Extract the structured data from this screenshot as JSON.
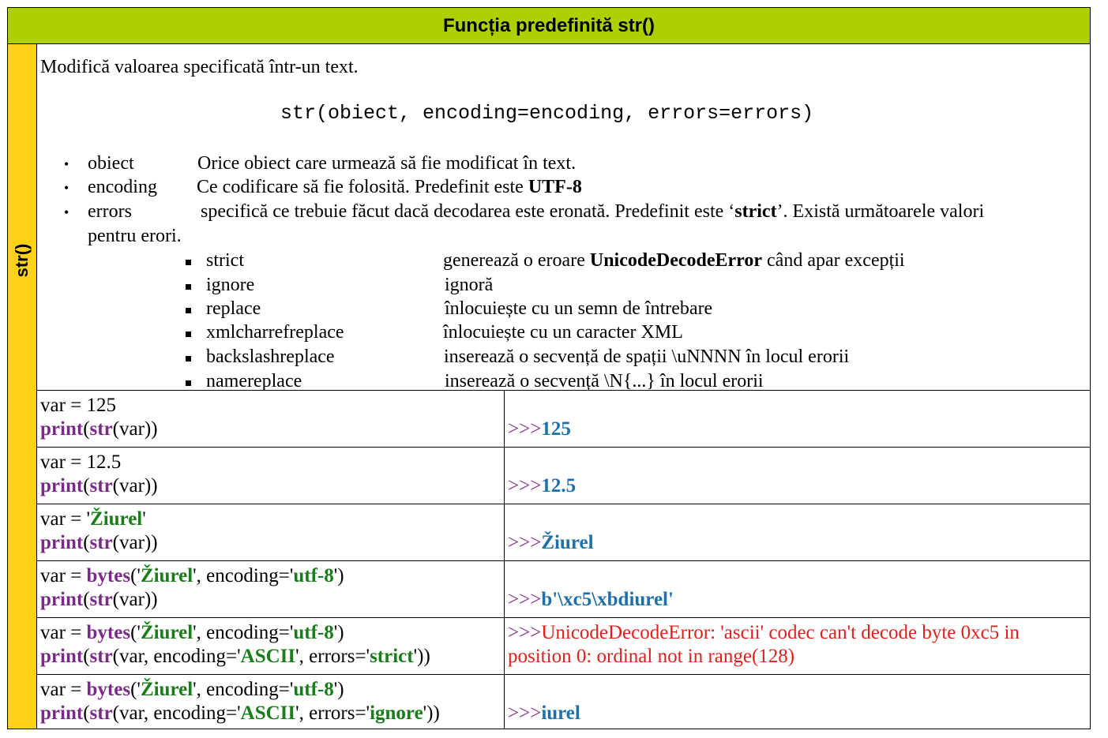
{
  "title": "Funcția predefinită str()",
  "side_label": "str()",
  "description": {
    "intro": "Modifică valoarea specificată într-un text.",
    "syntax": "str(obiect, encoding=encoding, errors=errors)",
    "params": [
      {
        "name": "obiect",
        "text": "Orice obiect care urmează să fie modificat în text.",
        "bold": ""
      },
      {
        "name": "encoding",
        "text": "Ce codificare să fie folosită. Predefinit este ",
        "bold": "UTF-8"
      },
      {
        "name": "errors",
        "text_a": "specifică ce trebuie făcut dacă decodarea este eronată. Predefinit este ‘",
        "bold": "strict",
        "text_b": "’. Există următoarele valori",
        "cont": "pentru erori."
      }
    ],
    "error_values": [
      {
        "name": "strict",
        "text_a": "generează o eroare ",
        "bold": "UnicodeDecodeError",
        "text_b": " când apar excepții"
      },
      {
        "name": "ignore",
        "text": "ignoră"
      },
      {
        "name": "replace",
        "text": "înlocuiește cu un semn de întrebare"
      },
      {
        "name": "xmlcharrefreplace",
        "text": "înlocuiește cu un caracter XML"
      },
      {
        "name": "backslashreplace",
        "text": "inserează o secvență de spații \\uNNNN în locul erorii"
      },
      {
        "name": "namereplace",
        "text": "inserează o secvență \\N{...} în locul erorii"
      }
    ]
  },
  "examples": [
    {
      "code": [
        [
          {
            "t": "var = 125",
            "c": ""
          }
        ],
        [
          {
            "t": "print",
            "c": "kw"
          },
          {
            "t": "(",
            "c": ""
          },
          {
            "t": "str",
            "c": "kw"
          },
          {
            "t": "(var))",
            "c": ""
          }
        ]
      ],
      "output": [
        [
          {
            "t": "",
            "c": ""
          }
        ],
        [
          {
            "t": ">>>",
            "c": "prompt"
          },
          {
            "t": "125",
            "c": "res"
          }
        ]
      ]
    },
    {
      "code": [
        [
          {
            "t": "var = 12.5",
            "c": ""
          }
        ],
        [
          {
            "t": "print",
            "c": "kw"
          },
          {
            "t": "(",
            "c": ""
          },
          {
            "t": "str",
            "c": "kw"
          },
          {
            "t": "(var))",
            "c": ""
          }
        ]
      ],
      "output": [
        [
          {
            "t": "",
            "c": ""
          }
        ],
        [
          {
            "t": ">>>",
            "c": "prompt"
          },
          {
            "t": "12.5",
            "c": "res"
          }
        ]
      ]
    },
    {
      "code": [
        [
          {
            "t": "var = '",
            "c": ""
          },
          {
            "t": "Žiurel",
            "c": "st"
          },
          {
            "t": "'",
            "c": ""
          }
        ],
        [
          {
            "t": "print",
            "c": "kw"
          },
          {
            "t": "(",
            "c": ""
          },
          {
            "t": "str",
            "c": "kw"
          },
          {
            "t": "(var))",
            "c": ""
          }
        ]
      ],
      "output": [
        [
          {
            "t": "",
            "c": ""
          }
        ],
        [
          {
            "t": ">>>",
            "c": "prompt"
          },
          {
            "t": "Žiurel",
            "c": "res"
          }
        ]
      ]
    },
    {
      "code": [
        [
          {
            "t": "var = ",
            "c": ""
          },
          {
            "t": "bytes",
            "c": "kw"
          },
          {
            "t": "('",
            "c": ""
          },
          {
            "t": "Žiurel",
            "c": "st"
          },
          {
            "t": "', encoding='",
            "c": ""
          },
          {
            "t": "utf-8",
            "c": "st"
          },
          {
            "t": "')",
            "c": ""
          }
        ],
        [
          {
            "t": "print",
            "c": "kw"
          },
          {
            "t": "(",
            "c": ""
          },
          {
            "t": "str",
            "c": "kw"
          },
          {
            "t": "(var))",
            "c": ""
          }
        ]
      ],
      "output": [
        [
          {
            "t": "",
            "c": ""
          }
        ],
        [
          {
            "t": ">>>",
            "c": "prompt"
          },
          {
            "t": "b'\\xc5\\xbdiurel'",
            "c": "res"
          }
        ]
      ]
    },
    {
      "code": [
        [
          {
            "t": "var = ",
            "c": ""
          },
          {
            "t": "bytes",
            "c": "kw"
          },
          {
            "t": "('",
            "c": ""
          },
          {
            "t": "Žiurel",
            "c": "st"
          },
          {
            "t": "', encoding='",
            "c": ""
          },
          {
            "t": "utf-8",
            "c": "st"
          },
          {
            "t": "')",
            "c": ""
          }
        ],
        [
          {
            "t": "print",
            "c": "kw"
          },
          {
            "t": "(",
            "c": ""
          },
          {
            "t": "str",
            "c": "kw"
          },
          {
            "t": "(var, encoding='",
            "c": ""
          },
          {
            "t": "ASCII",
            "c": "st"
          },
          {
            "t": "', errors='",
            "c": ""
          },
          {
            "t": "strict",
            "c": "st"
          },
          {
            "t": "'))",
            "c": ""
          }
        ]
      ],
      "output": [
        [
          {
            "t": ">>>",
            "c": "prompt"
          },
          {
            "t": "UnicodeDecodeError: 'ascii' codec can't decode byte 0xc5 in",
            "c": "err"
          }
        ],
        [
          {
            "t": "position 0: ordinal not in range(128)",
            "c": "err"
          }
        ]
      ]
    },
    {
      "code": [
        [
          {
            "t": "var = ",
            "c": ""
          },
          {
            "t": "bytes",
            "c": "kw"
          },
          {
            "t": "('",
            "c": ""
          },
          {
            "t": "Žiurel",
            "c": "st"
          },
          {
            "t": "', encoding='",
            "c": ""
          },
          {
            "t": "utf-8",
            "c": "st"
          },
          {
            "t": "')",
            "c": ""
          }
        ],
        [
          {
            "t": "print",
            "c": "kw"
          },
          {
            "t": "(",
            "c": ""
          },
          {
            "t": "str",
            "c": "kw"
          },
          {
            "t": "(var, encoding='",
            "c": ""
          },
          {
            "t": "ASCII",
            "c": "st"
          },
          {
            "t": "', errors='",
            "c": ""
          },
          {
            "t": "ignore",
            "c": "st"
          },
          {
            "t": "'))",
            "c": ""
          }
        ]
      ],
      "output": [
        [
          {
            "t": "",
            "c": ""
          }
        ],
        [
          {
            "t": ">>>",
            "c": "prompt"
          },
          {
            "t": "iurel",
            "c": "res"
          }
        ]
      ]
    }
  ]
}
